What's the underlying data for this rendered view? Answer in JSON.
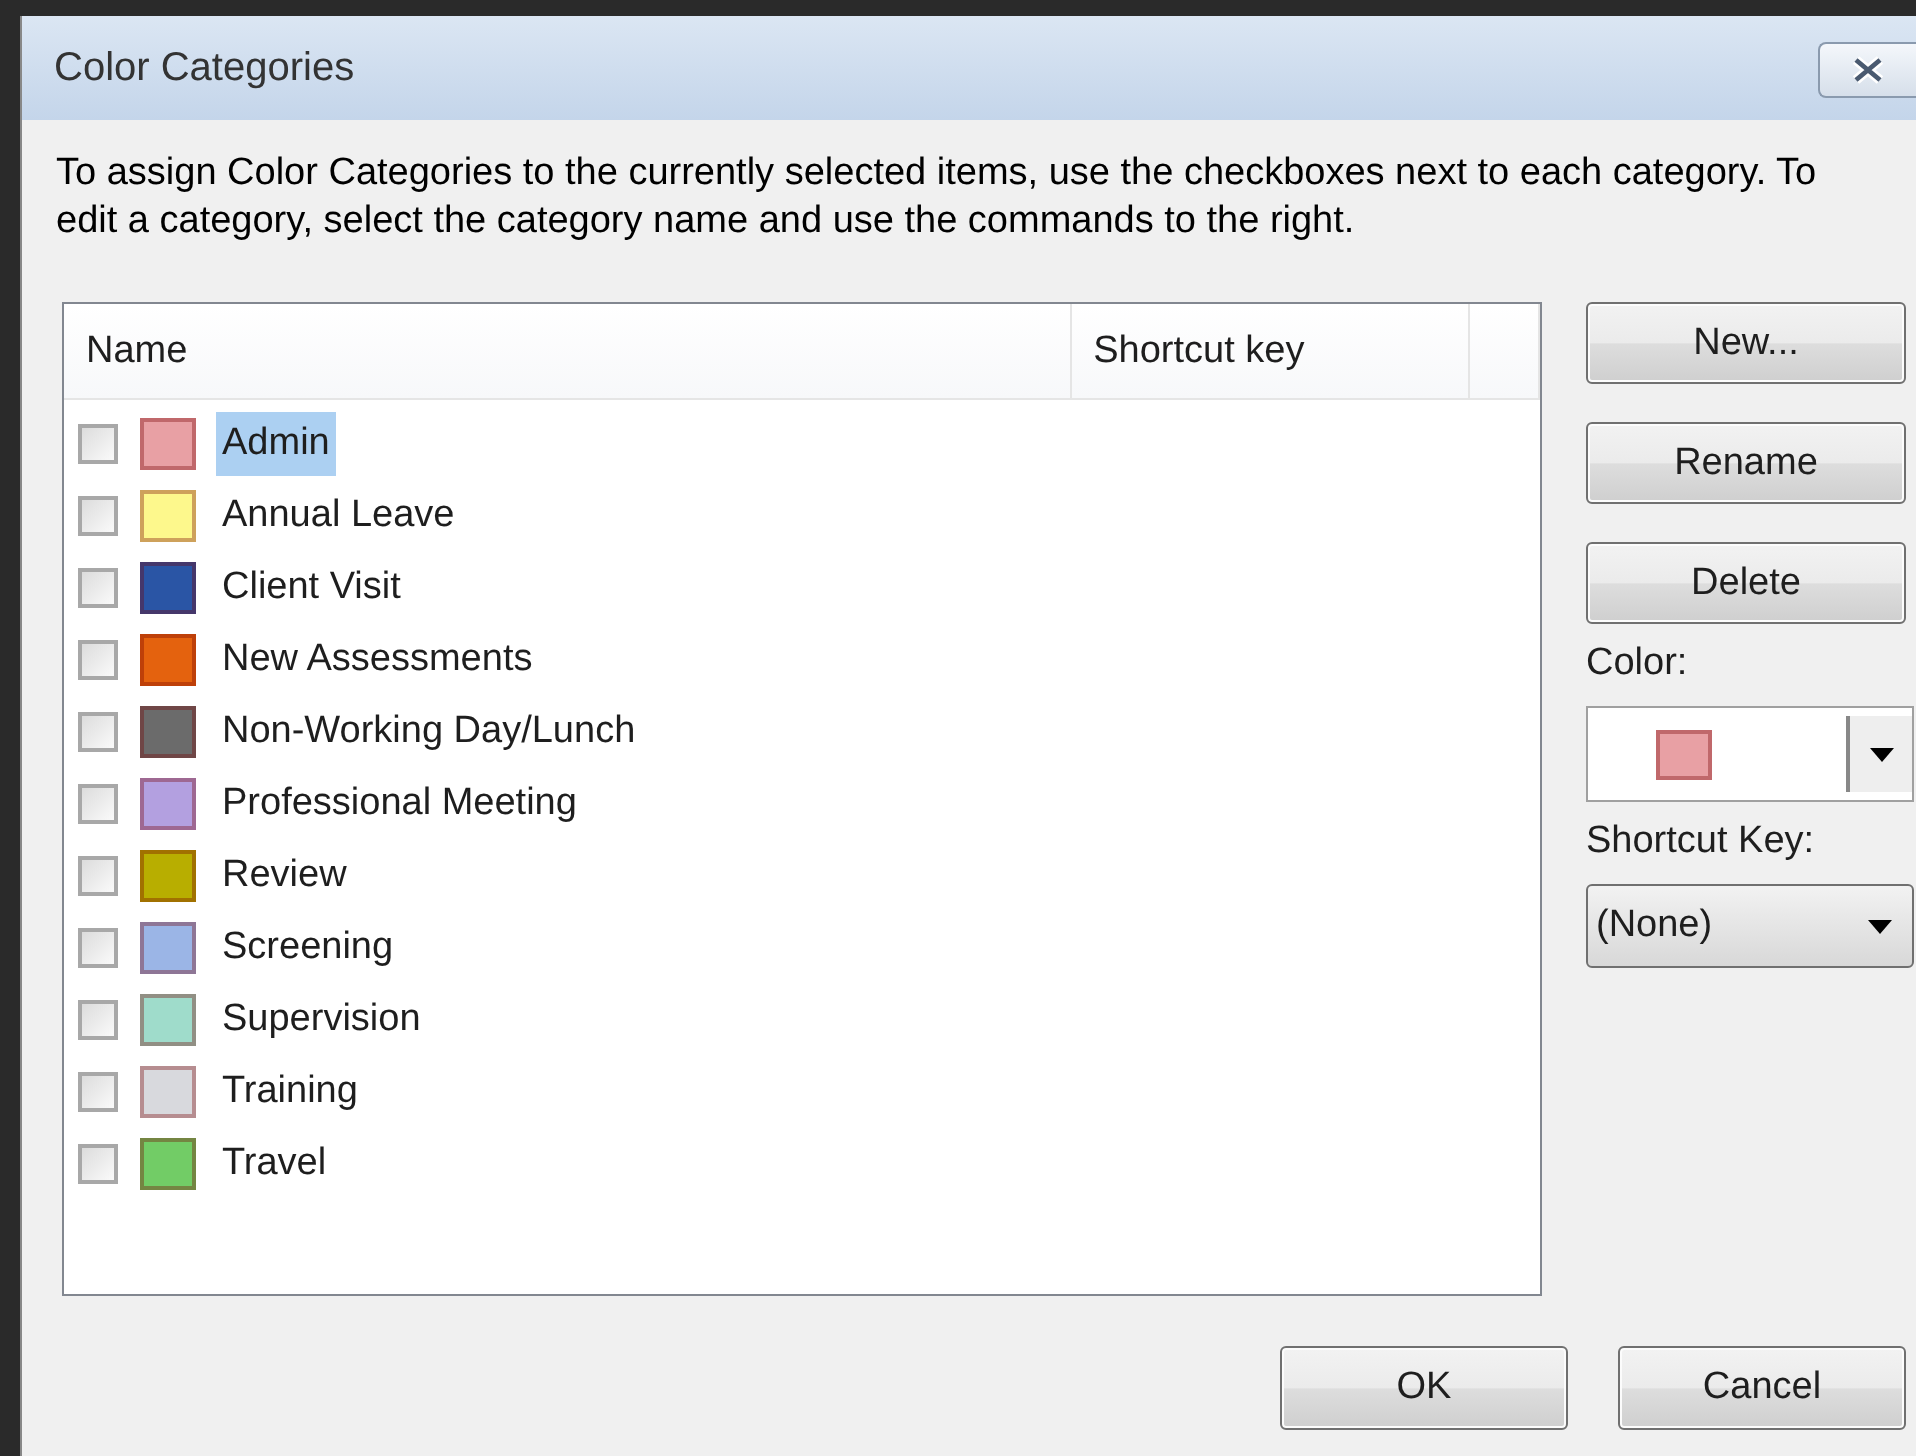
{
  "window": {
    "title": "Color Categories"
  },
  "instructions": "To assign Color Categories to the currently selected items, use the checkboxes next to each category.  To edit a category, select the category name and use the commands to the right.",
  "table": {
    "columns": [
      "Name",
      "Shortcut key"
    ],
    "rows": [
      {
        "name": "Admin",
        "checked": false,
        "selected": true,
        "color": "#e8a0a4"
      },
      {
        "name": "Annual Leave",
        "checked": false,
        "selected": false,
        "color": "#fdf88c"
      },
      {
        "name": "Client Visit",
        "checked": false,
        "selected": false,
        "color": "#2a55a5"
      },
      {
        "name": "New Assessments",
        "checked": false,
        "selected": false,
        "color": "#e4620e"
      },
      {
        "name": "Non-Working Day/Lunch",
        "checked": false,
        "selected": false,
        "color": "#6b6b6b"
      },
      {
        "name": "Professional Meeting",
        "checked": false,
        "selected": false,
        "color": "#b3a0e0"
      },
      {
        "name": "Review",
        "checked": false,
        "selected": false,
        "color": "#b8ae00"
      },
      {
        "name": "Screening",
        "checked": false,
        "selected": false,
        "color": "#9bb5e6"
      },
      {
        "name": "Supervision",
        "checked": false,
        "selected": false,
        "color": "#9fdccb"
      },
      {
        "name": "Training",
        "checked": false,
        "selected": false,
        "color": "#d8d9dd"
      },
      {
        "name": "Travel",
        "checked": false,
        "selected": false,
        "color": "#72cc66"
      }
    ]
  },
  "side_buttons": [
    "New...",
    "Rename",
    "Delete"
  ],
  "color_field": {
    "label": "Color:",
    "color": "#e8a0a4"
  },
  "shortcut_field": {
    "label": "Shortcut Key:",
    "value": "(None)"
  },
  "buttons": [
    "OK",
    "Cancel"
  ]
}
